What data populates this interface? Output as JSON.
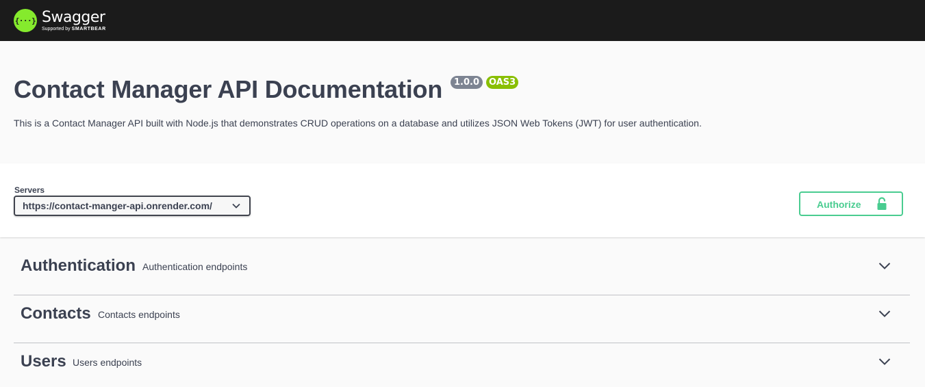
{
  "topbar": {
    "logo_mark": "{···}",
    "brand_name": "Swagger",
    "supported_by": "Supported by",
    "supporter": "SMARTBEAR"
  },
  "info": {
    "title": "Contact Manager API Documentation",
    "version_badge": "1.0.0",
    "oas_badge": "OAS3",
    "description": "This is a Contact Manager API built with Node.js that demonstrates CRUD operations on a database and utilizes JSON Web Tokens (JWT) for user authentication."
  },
  "servers": {
    "label": "Servers",
    "selected": "https://contact-manger-api.onrender.com/"
  },
  "authorize": {
    "label": "Authorize",
    "icon": "lock-icon"
  },
  "tags": [
    {
      "name": "Authentication",
      "description": "Authentication endpoints",
      "icon": "chevron-down-icon"
    },
    {
      "name": "Contacts",
      "description": "Contacts endpoints",
      "icon": "chevron-down-icon"
    },
    {
      "name": "Users",
      "description": "Users endpoints",
      "icon": "chevron-down-icon"
    }
  ],
  "colors": {
    "topbar_bg": "#1b1b1b",
    "brand_green": "#85ea2d",
    "text": "#3b4151",
    "version_badge": "#7d8492",
    "oas_badge": "#89bf04",
    "authorize": "#49cc90"
  }
}
